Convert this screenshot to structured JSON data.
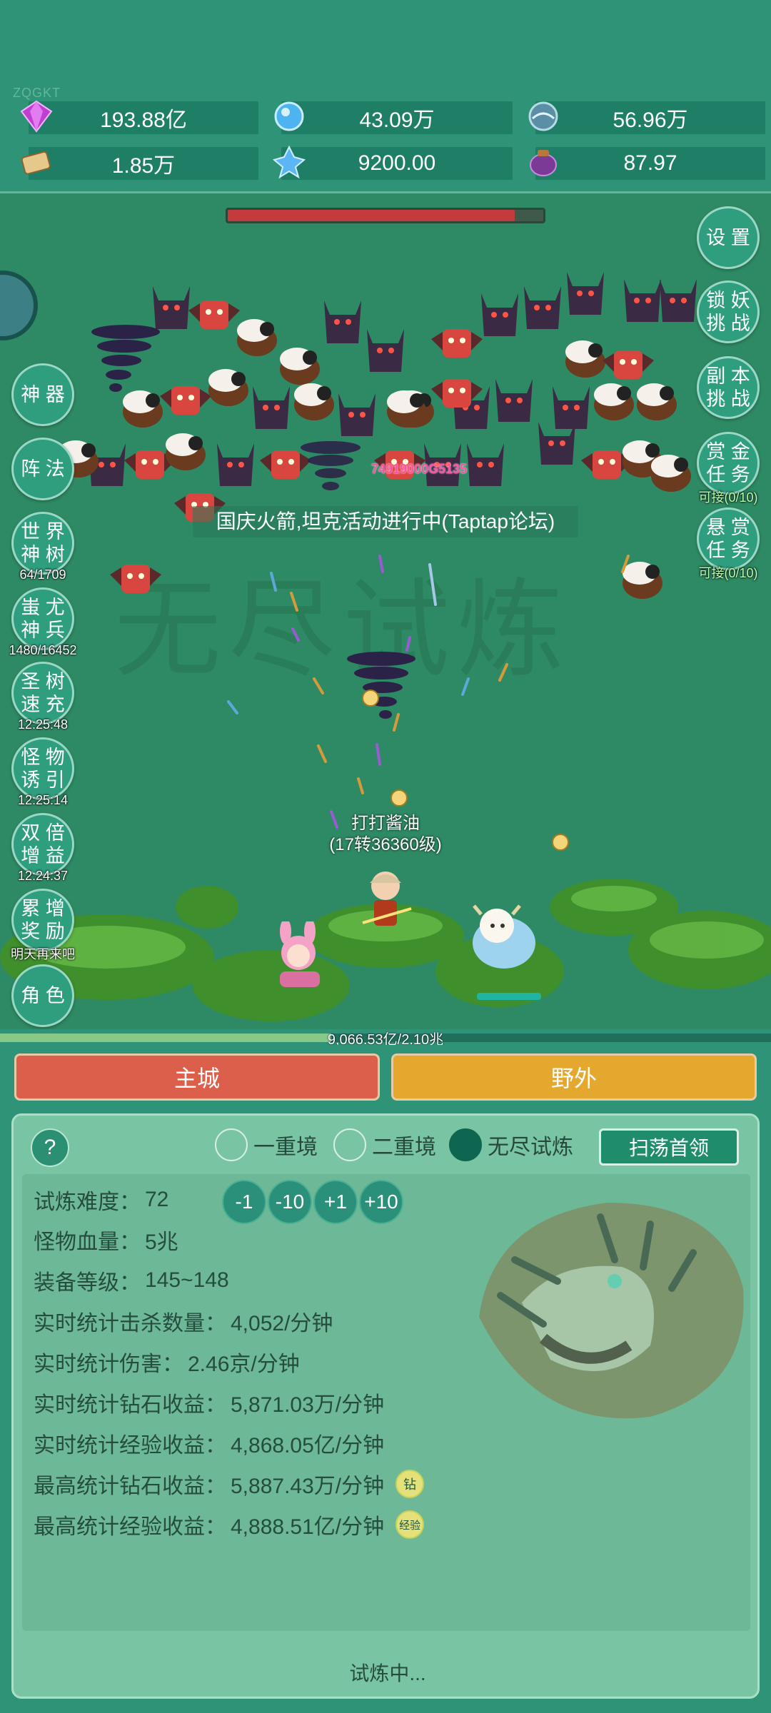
{
  "top": {
    "tag": "ZQGKT",
    "resources": [
      {
        "icon": "purple-gem-icon",
        "value": "193.88亿"
      },
      {
        "icon": "blue-diamond-icon",
        "value": "43.09万"
      },
      {
        "icon": "crystal-orb-icon",
        "value": "56.96万"
      },
      {
        "icon": "scroll-book-icon",
        "value": "1.85万"
      },
      {
        "icon": "ice-crystal-icon",
        "value": "9200.00"
      },
      {
        "icon": "purple-pouch-icon",
        "value": "87.97"
      }
    ]
  },
  "battle": {
    "boss_hp": 0.91,
    "banner": "国庆火箭,坦克活动进行中(Taptap论坛)",
    "damage": "74919000G5135",
    "player_name": "打打酱油",
    "player_level": "(17转36360级)",
    "bg_text": "无尽试炼",
    "exp": "9,066.53亿/2.10兆",
    "exp_fraction": 0.43,
    "left_buttons": [
      {
        "id": "shenqi",
        "label": "神 器",
        "sub": ""
      },
      {
        "id": "zhenfa",
        "label": "阵 法",
        "sub": ""
      },
      {
        "id": "shijie",
        "label": "世 界\n神 树",
        "sub": "64/1709"
      },
      {
        "id": "chiyou",
        "label": "蚩 尤\n神 兵",
        "sub": "1480/16452"
      },
      {
        "id": "shengshu",
        "label": "圣 树\n速 充",
        "sub": "12:25:48"
      },
      {
        "id": "guaiwu",
        "label": "怪 物\n诱 引",
        "sub": "12:25:14"
      },
      {
        "id": "shuangbei",
        "label": "双 倍\n增 益",
        "sub": "12:24:37"
      },
      {
        "id": "leizeng",
        "label": "累 增\n奖 励",
        "sub": "明天再来吧"
      },
      {
        "id": "juese",
        "label": "角 色",
        "sub": ""
      }
    ],
    "right_buttons": [
      {
        "id": "shezhi",
        "label": "设 置",
        "sub": ""
      },
      {
        "id": "suoyao",
        "label": "锁 妖\n挑 战",
        "sub": ""
      },
      {
        "id": "fuben",
        "label": "副 本\n挑 战",
        "sub": ""
      },
      {
        "id": "shangjin",
        "label": "赏 金\n任 务",
        "sub": "可接(0/10)"
      },
      {
        "id": "xuanshang",
        "label": "悬 赏\n任 务",
        "sub": "可接(0/10)"
      }
    ]
  },
  "tabs": {
    "main_city": "主城",
    "wild": "野外"
  },
  "panel": {
    "help": "?",
    "modes": [
      {
        "label": "一重境",
        "selected": false
      },
      {
        "label": "二重境",
        "selected": false
      },
      {
        "label": "无尽试炼",
        "selected": true
      }
    ],
    "sweep": "扫荡首领",
    "steps": [
      "-1",
      "-10",
      "+1",
      "+10"
    ],
    "stats": [
      {
        "label": "试炼难度：",
        "value": "72"
      },
      {
        "label": "怪物血量：",
        "value": "5兆"
      },
      {
        "label": "装备等级：",
        "value": "145~148"
      },
      {
        "label": "实时统计击杀数量：",
        "value": "4,052/分钟"
      },
      {
        "label": "实时统计伤害：",
        "value": "2.46京/分钟"
      },
      {
        "label": "实时统计钻石收益：",
        "value": "5,871.03万/分钟"
      },
      {
        "label": "实时统计经验收益：",
        "value": "4,868.05亿/分钟"
      },
      {
        "label": "最高统计钻石收益：",
        "value": "5,887.43万/分钟",
        "badge": "钻"
      },
      {
        "label": "最高统计经验收益：",
        "value": "4,888.51亿/分钟",
        "badge": "经验"
      }
    ],
    "status": "试炼中..."
  }
}
